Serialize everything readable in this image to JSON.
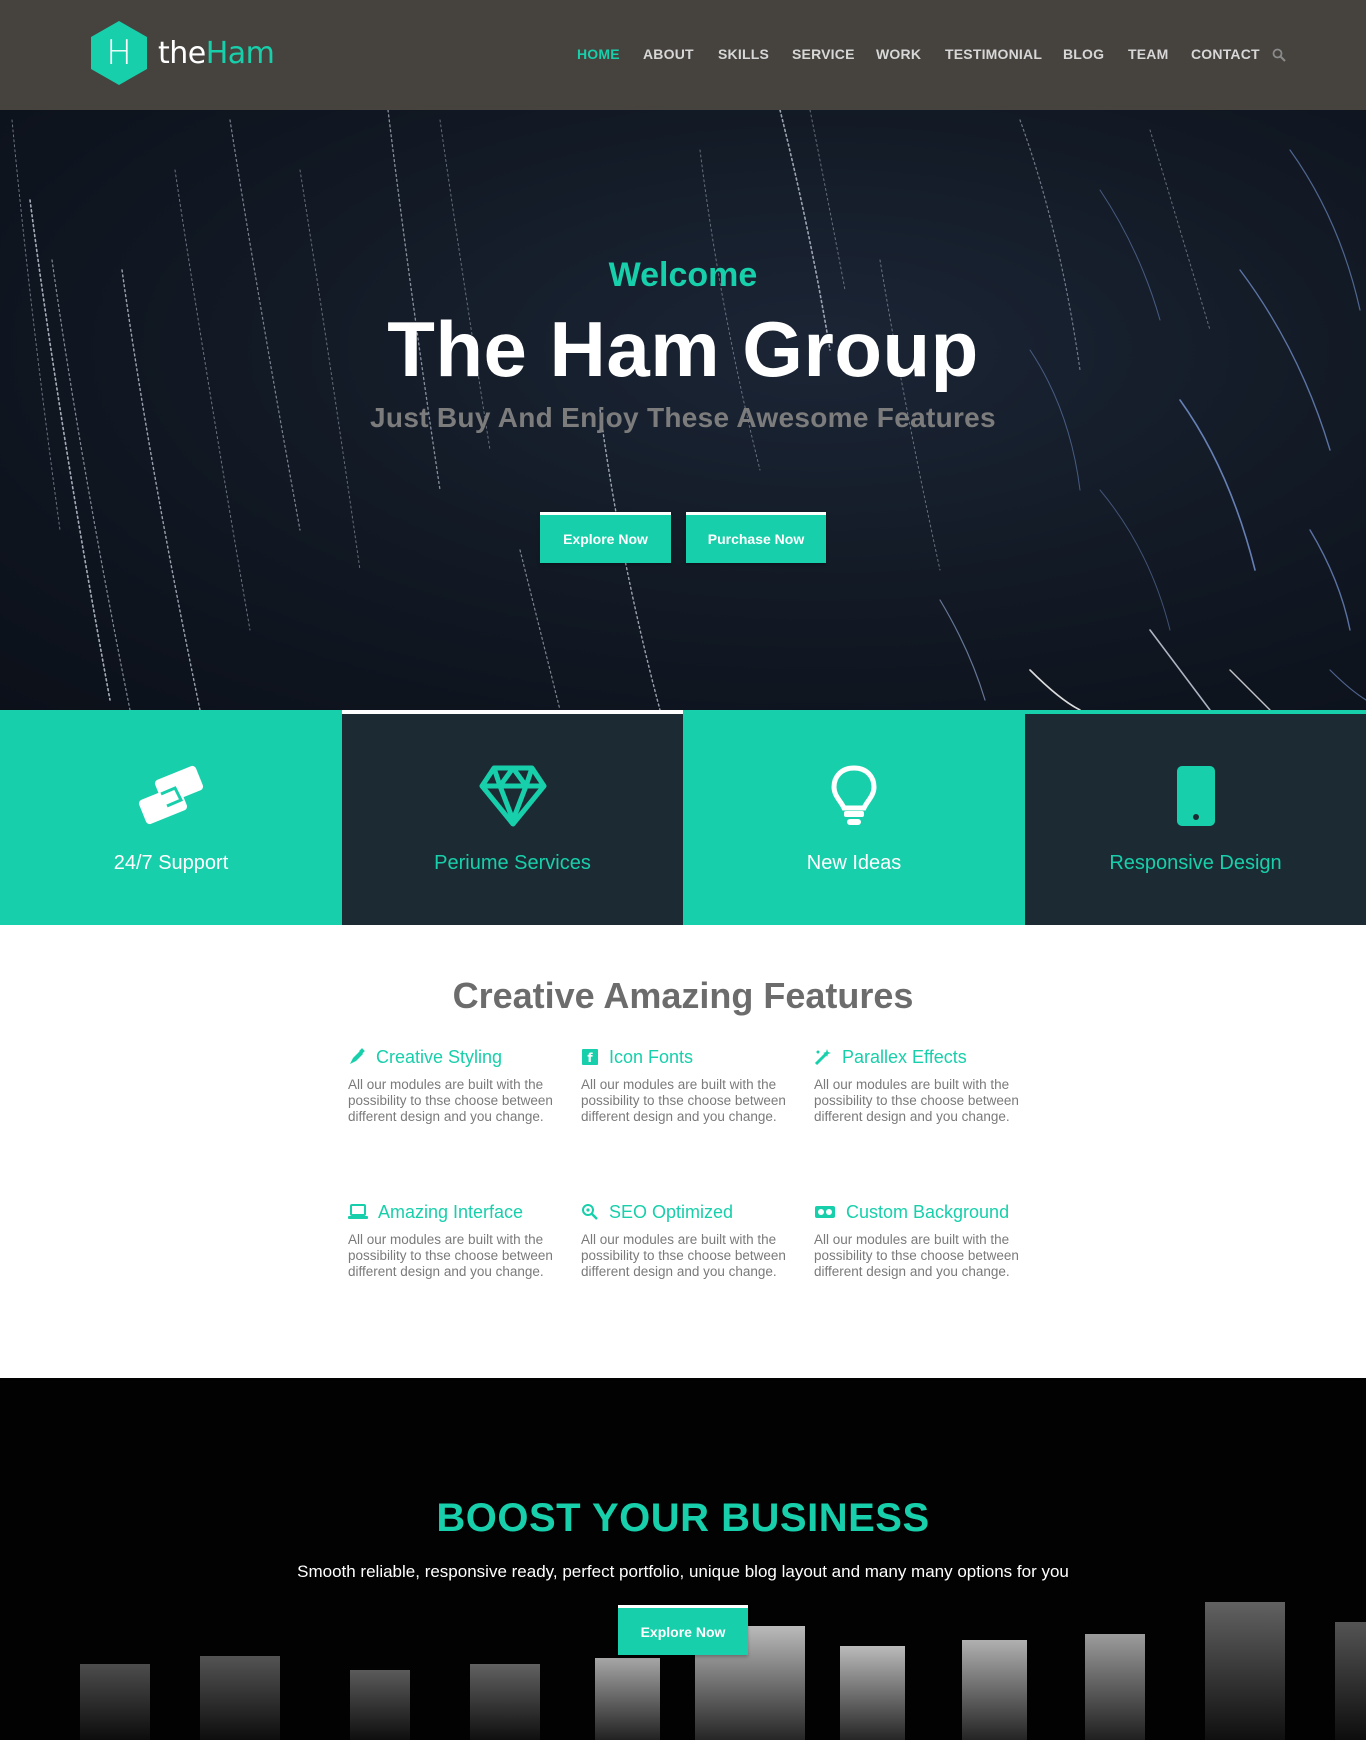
{
  "brand": {
    "logo_letter": "H",
    "name_part1": "the",
    "name_part2": "Ham"
  },
  "nav": {
    "items": [
      "HOME",
      "ABOUT",
      "SKILLS",
      "SERVICE",
      "WORK",
      "TESTIMONIAL",
      "BLOG",
      "TEAM",
      "CONTACT"
    ],
    "active": "HOME",
    "search_icon": "search-icon"
  },
  "hero": {
    "welcome": "Welcome",
    "title": "The Ham Group",
    "subtitle": "Just Buy And Enjoy These Awesome Features",
    "explore_label": "Explore Now",
    "purchase_label": "Purchase Now"
  },
  "services": [
    {
      "label": "24/7 Support",
      "icon": "handshake-icon"
    },
    {
      "label": "Periume Services",
      "icon": "diamond-icon"
    },
    {
      "label": "New Ideas",
      "icon": "lightbulb-icon"
    },
    {
      "label": "Responsive Design",
      "icon": "mobile-icon"
    }
  ],
  "features": {
    "title": "Creative Amazing Features",
    "items": [
      {
        "title": "Creative Styling",
        "icon": "pen-icon",
        "text": "All our modules are built with the possibility to thse choose between different design and you change."
      },
      {
        "title": "Icon Fonts",
        "icon": "font-icon",
        "text": "All our modules are built with the possibility to thse choose between different design and you change."
      },
      {
        "title": "Parallex Effects",
        "icon": "magic-wand-icon",
        "text": "All our modules are built with the possibility to thse choose between different design and you change."
      },
      {
        "title": "Amazing Interface",
        "icon": "laptop-icon",
        "text": "All our modules are built with the possibility to thse choose between different design and you change."
      },
      {
        "title": "SEO Optimized",
        "icon": "search-gear-icon",
        "text": "All our modules are built with the possibility to thse choose between different design and you change."
      },
      {
        "title": "Custom Background",
        "icon": "vr-headset-icon",
        "text": "All our modules are built with the possibility to thse choose between different design and you change."
      }
    ]
  },
  "boost": {
    "title": "BOOST YOUR BUSINESS",
    "text": "Smooth reliable, responsive ready, perfect portfolio, unique blog layout and many many options for you",
    "button_label": "Explore Now"
  },
  "colors": {
    "accent": "#18cfab",
    "header_bg": "#46433f",
    "tile_dark": "#1c2b33"
  }
}
